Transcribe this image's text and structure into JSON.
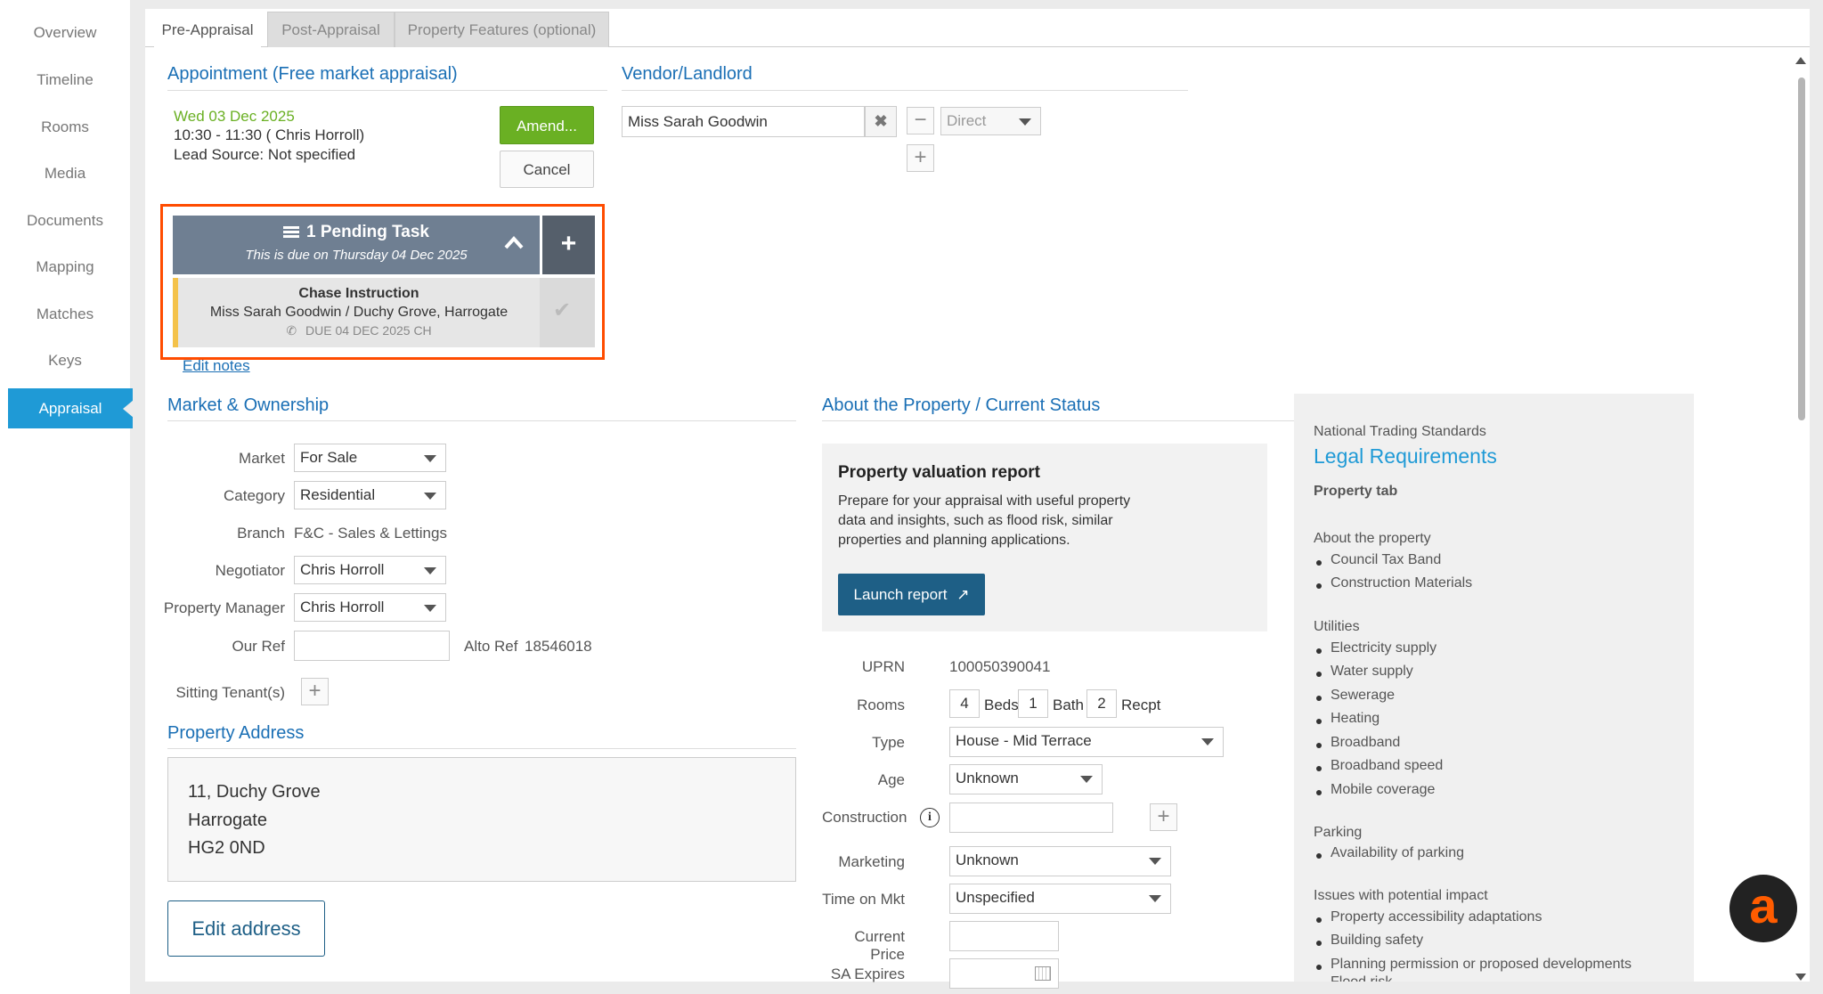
{
  "sidebar": {
    "items": [
      {
        "label": "Overview"
      },
      {
        "label": "Timeline"
      },
      {
        "label": "Rooms"
      },
      {
        "label": "Media"
      },
      {
        "label": "Documents"
      },
      {
        "label": "Mapping"
      },
      {
        "label": "Matches"
      },
      {
        "label": "Keys"
      },
      {
        "label": "Appraisal",
        "active": true
      }
    ]
  },
  "tabs": [
    {
      "label": "Pre-Appraisal",
      "active": true
    },
    {
      "label": "Post-Appraisal"
    },
    {
      "label": "Property Features (optional)"
    }
  ],
  "appointment": {
    "title": "Appointment (Free market appraisal)",
    "date": "Wed 03 Dec 2025",
    "time": "10:30 - 11:30 ( Chris Horroll)",
    "lead_source": "Lead Source: Not specified",
    "amend_label": "Amend...",
    "cancel_label": "Cancel"
  },
  "pending": {
    "title": "1 Pending Task",
    "due": "This is due on Thursday 04 Dec 2025",
    "task_title": "Chase Instruction",
    "task_sub": "Miss Sarah Goodwin / Duchy Grove, Harrogate",
    "task_due": "DUE 04 DEC 2025 CH",
    "edit_notes": "Edit notes"
  },
  "vendor": {
    "title": "Vendor/Landlord",
    "name": "Miss Sarah Goodwin",
    "relationship": "Direct"
  },
  "market": {
    "title": "Market & Ownership",
    "market_label": "Market",
    "market_value": "For Sale",
    "category_label": "Category",
    "category_value": "Residential",
    "branch_label": "Branch",
    "branch_value": "F&C - Sales & Lettings",
    "negotiator_label": "Negotiator",
    "negotiator_value": "Chris Horroll",
    "pm_label": "Property Manager",
    "pm_value": "Chris Horroll",
    "ourref_label": "Our Ref",
    "ourref_value": "",
    "altoref_label": "Alto Ref",
    "altoref_value": "18546018",
    "sitting_label": "Sitting Tenant(s)"
  },
  "address": {
    "title": "Property Address",
    "line1": "11, Duchy Grove",
    "line2": "Harrogate",
    "line3": "HG2 0ND",
    "edit_label": "Edit address"
  },
  "about": {
    "title": "About the Property / Current Status",
    "report_title": "Property valuation report",
    "report_text": "Prepare for your appraisal with useful property data and insights, such as flood risk, similar properties and planning applications.",
    "launch_label": "Launch report",
    "uprn_label": "UPRN",
    "uprn_value": "100050390041",
    "rooms_label": "Rooms",
    "beds": "4",
    "beds_label": "Beds",
    "baths": "1",
    "baths_label": "Bath",
    "recepts": "2",
    "recepts_label": "Recpt",
    "type_label": "Type",
    "type_value": "House - Mid Terrace",
    "age_label": "Age",
    "age_value": "Unknown",
    "construction_label": "Construction",
    "marketing_label": "Marketing",
    "marketing_value": "Unknown",
    "time_label": "Time on Mkt",
    "time_value": "Unspecified",
    "price_label": "Current Price",
    "sa_label": "SA Expires"
  },
  "legal": {
    "kicker": "National Trading Standards",
    "title": "Legal Requirements",
    "tab_title": "Property tab",
    "groups": [
      {
        "heading": "About the property",
        "items": [
          "Council Tax Band",
          "Construction Materials"
        ]
      },
      {
        "heading": "Utilities",
        "items": [
          "Electricity supply",
          "Water supply",
          "Sewerage",
          "Heating",
          "Broadband",
          "Broadband speed",
          "Mobile coverage"
        ]
      },
      {
        "heading": "Parking",
        "items": [
          "Availability of parking"
        ]
      },
      {
        "heading": "Issues with potential impact",
        "items": [
          "Property accessibility adaptations",
          "Building safety",
          "Planning permission or proposed developments",
          "Flood risk"
        ]
      }
    ]
  },
  "colors": {
    "accent": "#1a6fb5",
    "active_tab": "#1f9ad6",
    "amend_green": "#6ab023",
    "task_header": "#6f7f92",
    "highlight": "#ff4c00",
    "launch": "#1e5f86",
    "chat_orange": "#ff5c00"
  }
}
